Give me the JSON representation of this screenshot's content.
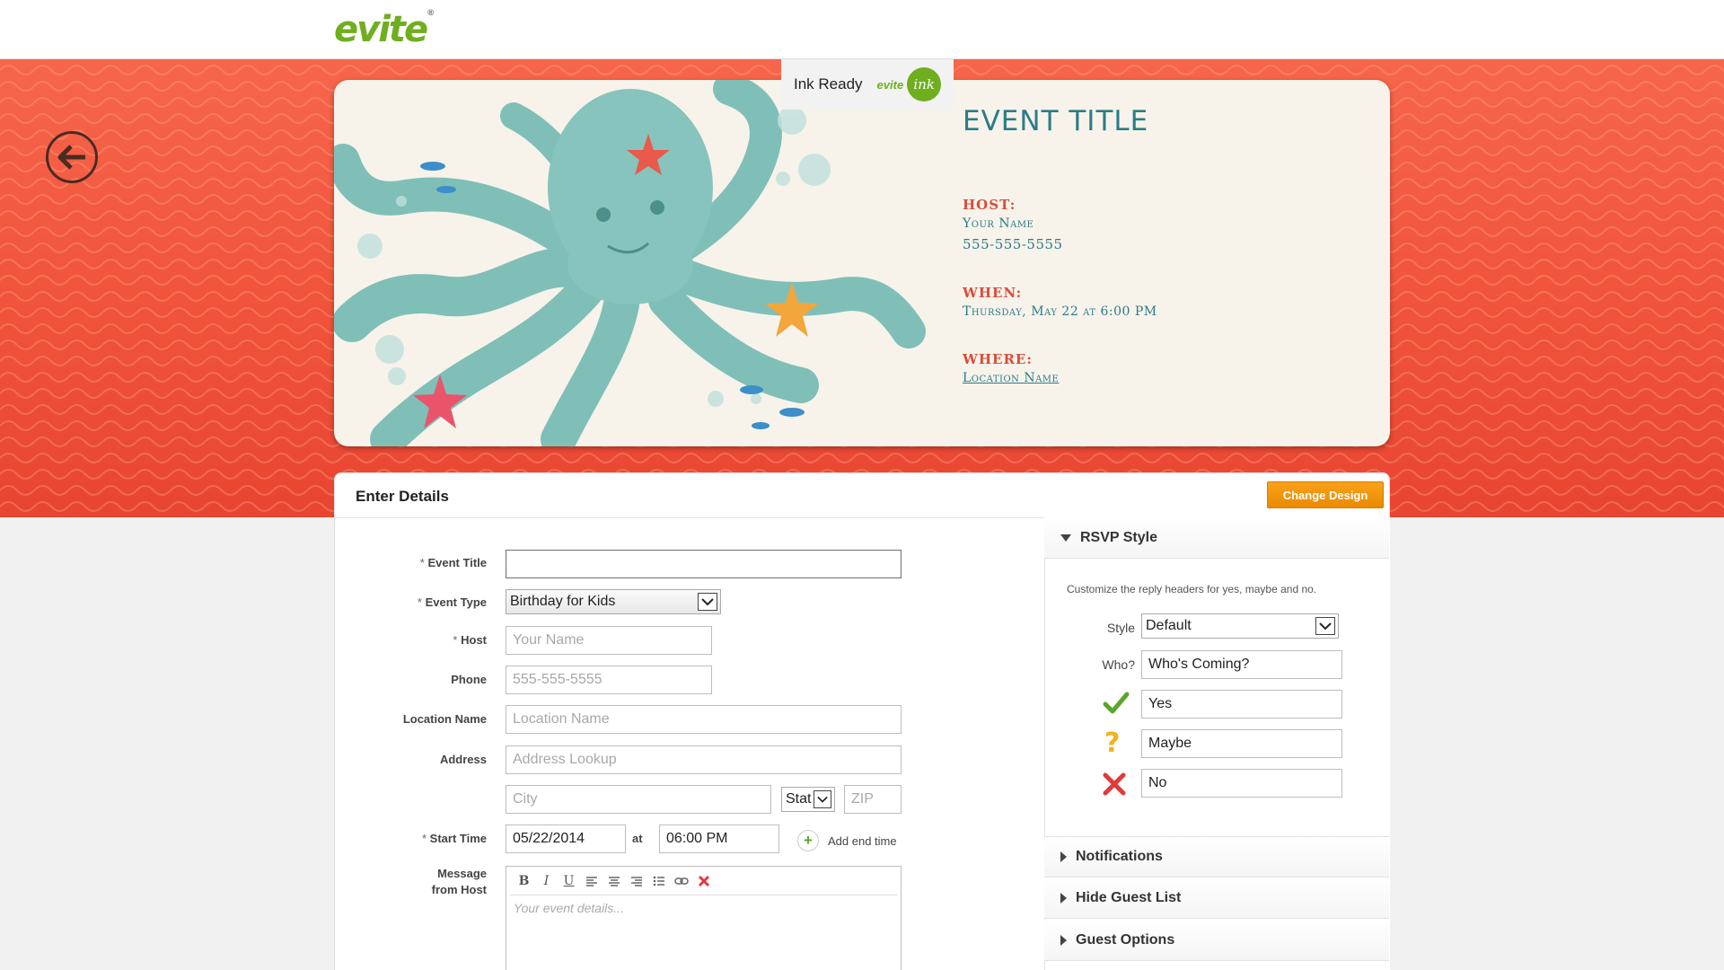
{
  "header": {
    "logo_text": "evite",
    "logo_mark": "®"
  },
  "card": {
    "badge": {
      "label": "Ink Ready",
      "brand": "evite",
      "ink": "ink"
    },
    "event_title": "EVENT TITLE",
    "host_label": "HOST:",
    "host_name": "Your Name",
    "host_phone": "555-555-5555",
    "when_label": "WHEN:",
    "when_value": "Thursday, May 22 at 6:00 PM",
    "where_label": "WHERE:",
    "where_value": "Location Name"
  },
  "panel": {
    "title": "Enter Details",
    "change_design": "Change Design"
  },
  "form": {
    "required_mark": "*",
    "event_title": {
      "label": "Event Title",
      "value": ""
    },
    "event_type": {
      "label": "Event Type",
      "value": "Birthday for Kids"
    },
    "host": {
      "label": "Host",
      "placeholder": "Your Name"
    },
    "phone": {
      "label": "Phone",
      "placeholder": "555-555-5555"
    },
    "location": {
      "label": "Location Name",
      "placeholder": "Location Name"
    },
    "address": {
      "label": "Address",
      "placeholder": "Address Lookup"
    },
    "city": {
      "placeholder": "City"
    },
    "state": {
      "value": "Stat"
    },
    "zip": {
      "placeholder": "ZIP"
    },
    "start_time": {
      "label": "Start Time",
      "date": "05/22/2014",
      "at": "at",
      "time": "06:00 PM"
    },
    "add_end_time": "Add end time",
    "message": {
      "label_line1": "Message",
      "label_line2": "from Host",
      "placeholder": "Your event details..."
    }
  },
  "sidebar": {
    "rsvp_style": {
      "title": "RSVP Style",
      "description": "Customize the reply headers for yes, maybe and no.",
      "style_label": "Style",
      "style_value": "Default",
      "who_label": "Who?",
      "who_value": "Who's Coming?",
      "yes_value": "Yes",
      "maybe_value": "Maybe",
      "no_value": "No"
    },
    "notifications": "Notifications",
    "hide_guest_list": "Hide Guest List",
    "guest_options": "Guest Options"
  },
  "colors": {
    "accent_orange": "#f49a10",
    "banner_red": "#f0533a",
    "card_teal": "#2b7c86",
    "card_red": "#d94c3a",
    "brand_green": "#6fae1e"
  }
}
